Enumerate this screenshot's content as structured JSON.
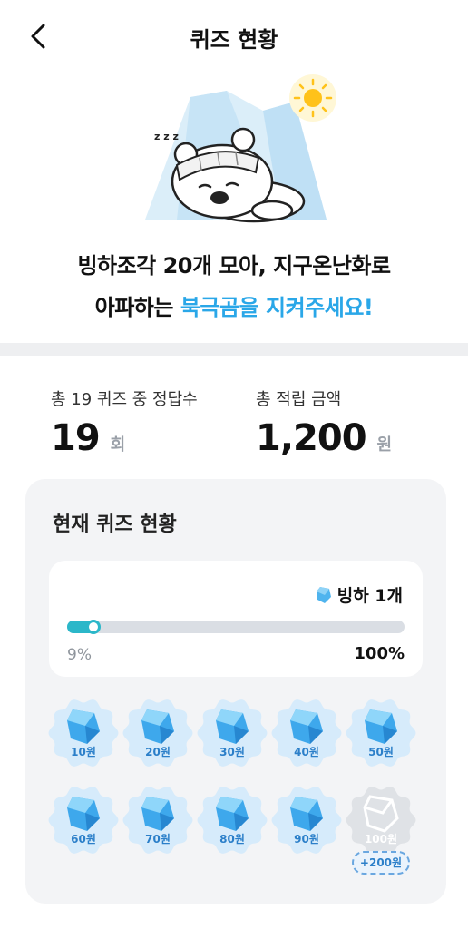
{
  "header": {
    "title": "퀴즈 현황"
  },
  "headline": {
    "line1": "빙하조각 20개 모아, 지구온난화로",
    "line2_prefix": "아파하는 ",
    "line2_accent": "북극곰을 지켜주세요!"
  },
  "stats": {
    "answers": {
      "label": "총 19 퀴즈 중 정답수",
      "value": "19",
      "unit": "회"
    },
    "amount": {
      "label": "총 적립 금액",
      "value": "1,200",
      "unit": "원"
    }
  },
  "panel": {
    "title": "현재 퀴즈 현황",
    "ice_count": "빙하 1개",
    "progress": {
      "value_percent": 9,
      "left_label": "9%",
      "right_label": "100%"
    },
    "rewards": [
      {
        "label": "10원",
        "state": "earned"
      },
      {
        "label": "20원",
        "state": "earned"
      },
      {
        "label": "30원",
        "state": "earned"
      },
      {
        "label": "40원",
        "state": "earned"
      },
      {
        "label": "50원",
        "state": "earned"
      },
      {
        "label": "60원",
        "state": "earned"
      },
      {
        "label": "70원",
        "state": "earned"
      },
      {
        "label": "80원",
        "state": "earned"
      },
      {
        "label": "90원",
        "state": "earned"
      },
      {
        "label": "100원",
        "state": "locked"
      }
    ],
    "bonus_label": "+200원"
  },
  "colors": {
    "accent": "#2aa7e8",
    "progress": "#2bb7c9",
    "badge_bg": "#d6ebfb",
    "locked_bg": "#dfe2e6"
  },
  "icons": {
    "back": "chevron-left-icon",
    "ice": "ice-crystal-icon",
    "sun": "sun-icon",
    "bear": "polar-bear-illustration"
  }
}
